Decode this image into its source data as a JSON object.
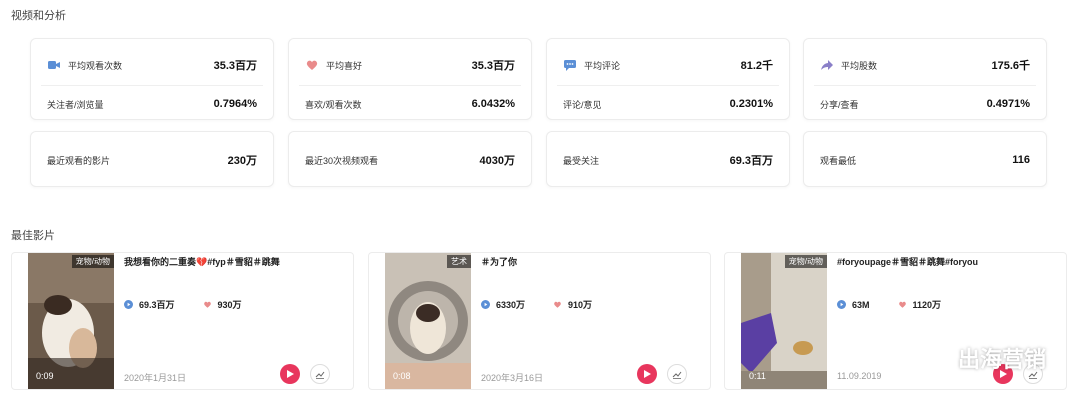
{
  "sections": {
    "overview_title": "视频和分析",
    "best_title": "最佳影片"
  },
  "stat_cards": [
    {
      "icon": "video-camera-icon",
      "color": "#5b8fd6",
      "label1": "平均观看次数",
      "value1": "35.3百万",
      "label2": "关注者/浏览量",
      "value2": "0.7964%"
    },
    {
      "icon": "heart-icon",
      "color": "#e98b8b",
      "label1": "平均喜好",
      "value1": "35.3百万",
      "label2": "喜欢/观看次数",
      "value2": "6.0432%"
    },
    {
      "icon": "comment-icon",
      "color": "#5b8fd6",
      "label1": "平均评论",
      "value1": "81.2千",
      "label2": "评论/意见",
      "value2": "0.2301%"
    },
    {
      "icon": "share-arrow-icon",
      "color": "#8a7fc8",
      "label1": "平均股数",
      "value1": "175.6千",
      "label2": "分享/查看",
      "value2": "0.4971%"
    }
  ],
  "single_cards": [
    {
      "label": "最近观看的影片",
      "value": "230万"
    },
    {
      "label": "最近30次视频观看",
      "value": "4030万"
    },
    {
      "label": "最受关注",
      "value": "69.3百万"
    },
    {
      "label": "观看最低",
      "value": "116"
    }
  ],
  "videos": [
    {
      "tag": "宠物/动物",
      "duration": "0:09",
      "title": "我想看你的二重奏💔#fyp＃雪貂＃跳舞",
      "views": "69.3百万",
      "likes": "930万",
      "date": "2020年1月31日"
    },
    {
      "tag": "艺术",
      "duration": "0:08",
      "title": "＃为了你",
      "views": "6330万",
      "likes": "910万",
      "date": "2020年3月16日"
    },
    {
      "tag": "宠物/动物",
      "duration": "0:11",
      "title": "#foryoupage＃雪貂＃跳舞#foryou",
      "views": "63M",
      "likes": "1120万",
      "date": "11.09.2019"
    }
  ],
  "watermark": {
    "text": "出海营销",
    "icon": "wechat-icon"
  },
  "colors": {
    "accent": "#e8365d",
    "views_icon": "#5b8fd6",
    "likes_icon": "#e98b8b"
  }
}
